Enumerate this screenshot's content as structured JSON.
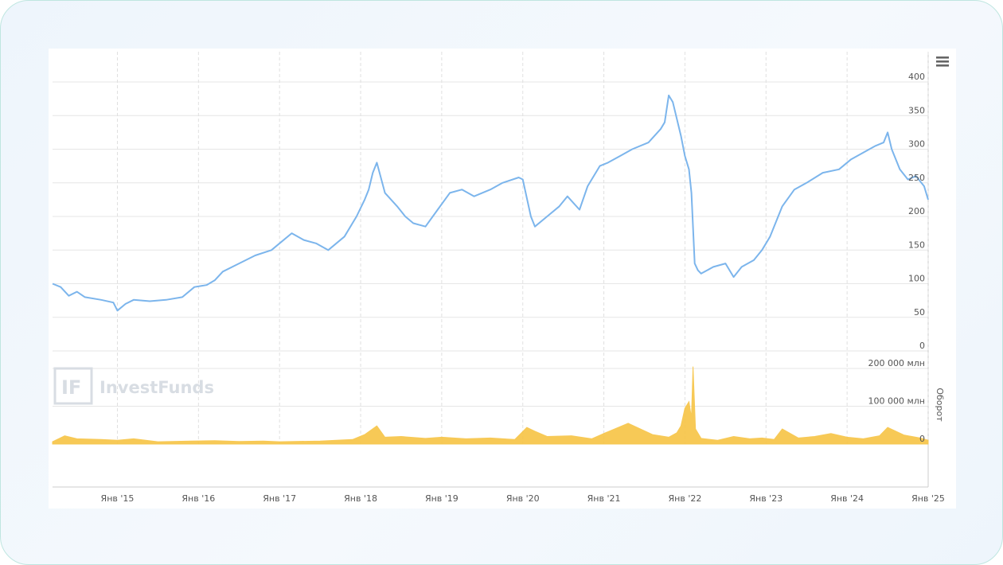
{
  "watermark": {
    "text": "InvestFunds",
    "logo": "IF"
  },
  "menu": {
    "icon": "hamburger-menu-icon"
  },
  "colors": {
    "price": "#7cb5ec",
    "volume": "#f7c444",
    "grid": "#e6e6e6",
    "text": "#555555",
    "frame_border": "#bfe6e0"
  },
  "chart_data": [
    {
      "type": "line",
      "title": "",
      "xlabel": "",
      "ylabel": "",
      "ylim": [
        0,
        400
      ],
      "yticks": [
        "400",
        "350",
        "300",
        "250",
        "200",
        "150",
        "100",
        "50",
        "0"
      ],
      "grid": true,
      "xrange": [
        2014.2,
        2025.0
      ],
      "series": [
        {
          "x": [
            2014.2,
            2014.3,
            2014.4,
            2014.5,
            2014.6,
            2014.8,
            2014.95,
            2015.0,
            2015.1,
            2015.2,
            2015.4,
            2015.6,
            2015.8,
            2015.95,
            2016.1,
            2016.2,
            2016.3,
            2016.5,
            2016.7,
            2016.9,
            2017.0,
            2017.15,
            2017.3,
            2017.45,
            2017.6,
            2017.8,
            2017.95,
            2018.05,
            2018.1,
            2018.15,
            2018.2,
            2018.3,
            2018.45,
            2018.55,
            2018.65,
            2018.8,
            2018.95,
            2019.1,
            2019.25,
            2019.4,
            2019.6,
            2019.75,
            2019.95,
            2020.0,
            2020.1,
            2020.15,
            2020.3,
            2020.45,
            2020.55,
            2020.7,
            2020.8,
            2020.95,
            2021.05,
            2021.2,
            2021.35,
            2021.55,
            2021.7,
            2021.75,
            2021.8,
            2021.85,
            2021.95,
            2022.0,
            2022.05,
            2022.08,
            2022.12,
            2022.16,
            2022.2,
            2022.35,
            2022.5,
            2022.6,
            2022.7,
            2022.85,
            2022.95,
            2023.05,
            2023.2,
            2023.35,
            2023.5,
            2023.7,
            2023.9,
            2024.05,
            2024.2,
            2024.35,
            2024.45,
            2024.5,
            2024.55,
            2024.65,
            2024.75,
            2024.85,
            2024.95,
            2025.0
          ],
          "values": [
            100,
            95,
            82,
            88,
            80,
            76,
            72,
            60,
            70,
            76,
            74,
            76,
            80,
            95,
            98,
            105,
            118,
            130,
            142,
            150,
            160,
            175,
            165,
            160,
            150,
            170,
            200,
            225,
            240,
            265,
            280,
            235,
            215,
            200,
            190,
            185,
            210,
            235,
            240,
            230,
            240,
            250,
            258,
            255,
            200,
            185,
            200,
            215,
            230,
            210,
            245,
            275,
            280,
            290,
            300,
            310,
            330,
            340,
            380,
            370,
            320,
            290,
            270,
            235,
            130,
            120,
            115,
            125,
            130,
            110,
            125,
            135,
            150,
            170,
            215,
            240,
            250,
            265,
            270,
            285,
            295,
            305,
            310,
            325,
            300,
            270,
            255,
            260,
            245,
            225
          ]
        }
      ]
    },
    {
      "type": "area",
      "title": "",
      "ylabel": "Оборот",
      "ylim": [
        0,
        200000
      ],
      "yticks": [
        "200 000 млн",
        "100 000 млн",
        "0"
      ],
      "grid": true,
      "xrange": [
        2014.2,
        2025.0
      ],
      "series": [
        {
          "x": [
            2014.2,
            2014.35,
            2014.5,
            2014.8,
            2015.0,
            2015.2,
            2015.5,
            2015.9,
            2016.2,
            2016.5,
            2016.8,
            2017.0,
            2017.5,
            2017.9,
            2018.05,
            2018.2,
            2018.3,
            2018.5,
            2018.8,
            2019.0,
            2019.3,
            2019.6,
            2019.9,
            2020.05,
            2020.15,
            2020.3,
            2020.6,
            2020.85,
            2021.0,
            2021.3,
            2021.6,
            2021.8,
            2021.9,
            2021.95,
            2022.0,
            2022.05,
            2022.08,
            2022.1,
            2022.13,
            2022.2,
            2022.4,
            2022.6,
            2022.8,
            2022.95,
            2023.1,
            2023.2,
            2023.4,
            2023.6,
            2023.8,
            2024.0,
            2024.2,
            2024.4,
            2024.5,
            2024.7,
            2024.9,
            2025.0
          ],
          "values": [
            6000,
            22000,
            14000,
            12000,
            10000,
            14000,
            6000,
            8000,
            9000,
            7000,
            8000,
            6000,
            8000,
            12000,
            25000,
            48000,
            18000,
            20000,
            15000,
            18000,
            14000,
            16000,
            12000,
            44000,
            34000,
            20000,
            22000,
            14000,
            28000,
            55000,
            25000,
            18000,
            30000,
            48000,
            95000,
            112000,
            70000,
            205000,
            40000,
            15000,
            10000,
            20000,
            14000,
            16000,
            12000,
            40000,
            16000,
            20000,
            28000,
            18000,
            14000,
            22000,
            44000,
            24000,
            16000,
            10000
          ]
        }
      ]
    }
  ],
  "x_axis": {
    "ticks": [
      {
        "label": "Янв '15",
        "x": 2015.0
      },
      {
        "label": "Янв '16",
        "x": 2016.0
      },
      {
        "label": "Янв '17",
        "x": 2017.0
      },
      {
        "label": "Янв '18",
        "x": 2018.0
      },
      {
        "label": "Янв '19",
        "x": 2019.0
      },
      {
        "label": "Янв '20",
        "x": 2020.0
      },
      {
        "label": "Янв '21",
        "x": 2021.0
      },
      {
        "label": "Янв '22",
        "x": 2022.0
      },
      {
        "label": "Янв '23",
        "x": 2023.0
      },
      {
        "label": "Янв '24",
        "x": 2024.0
      },
      {
        "label": "Янв '25",
        "x": 2025.0
      }
    ]
  }
}
